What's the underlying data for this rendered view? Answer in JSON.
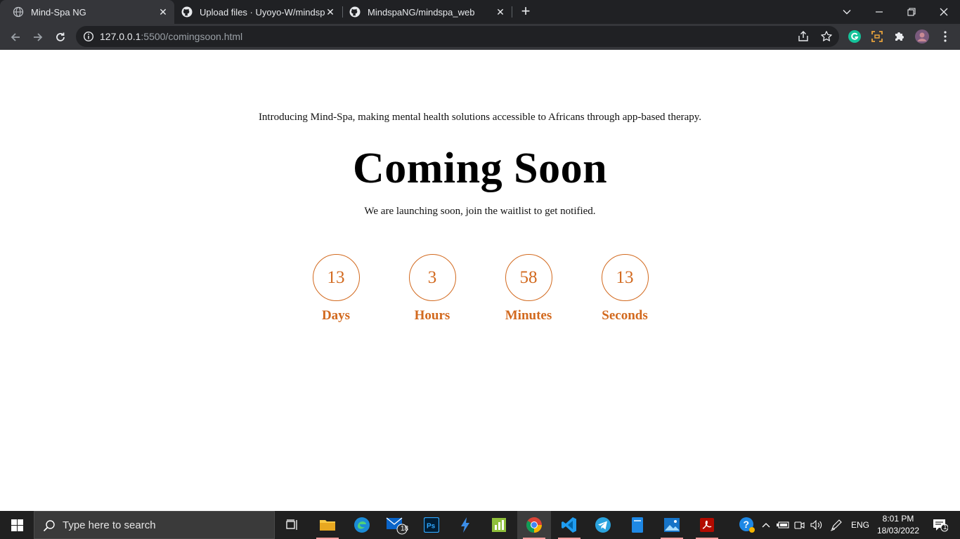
{
  "browser": {
    "tabs": [
      {
        "title": "Mind-Spa NG"
      },
      {
        "title": "Upload files · Uyoyo-W/mindspa"
      },
      {
        "title": "MindspaNG/mindspa_web"
      }
    ],
    "url_host": "127.0.0.1",
    "url_rest": ":5500/comingsoon.html"
  },
  "page": {
    "intro": "Introducing Mind-Spa, making mental health solutions accessible to Africans through app-based therapy.",
    "headline": "Coming Soon",
    "subline": "We are launching soon, join the waitlist to get notified.",
    "countdown": [
      {
        "value": "13",
        "label": "Days"
      },
      {
        "value": "3",
        "label": "Hours"
      },
      {
        "value": "58",
        "label": "Minutes"
      },
      {
        "value": "13",
        "label": "Seconds"
      }
    ],
    "accent_color": "#d2691e"
  },
  "taskbar": {
    "search_placeholder": "Type here to search",
    "mail_badge": "18",
    "language": "ENG",
    "time": "8:01 PM",
    "date": "18/03/2022",
    "notifications": "1"
  }
}
